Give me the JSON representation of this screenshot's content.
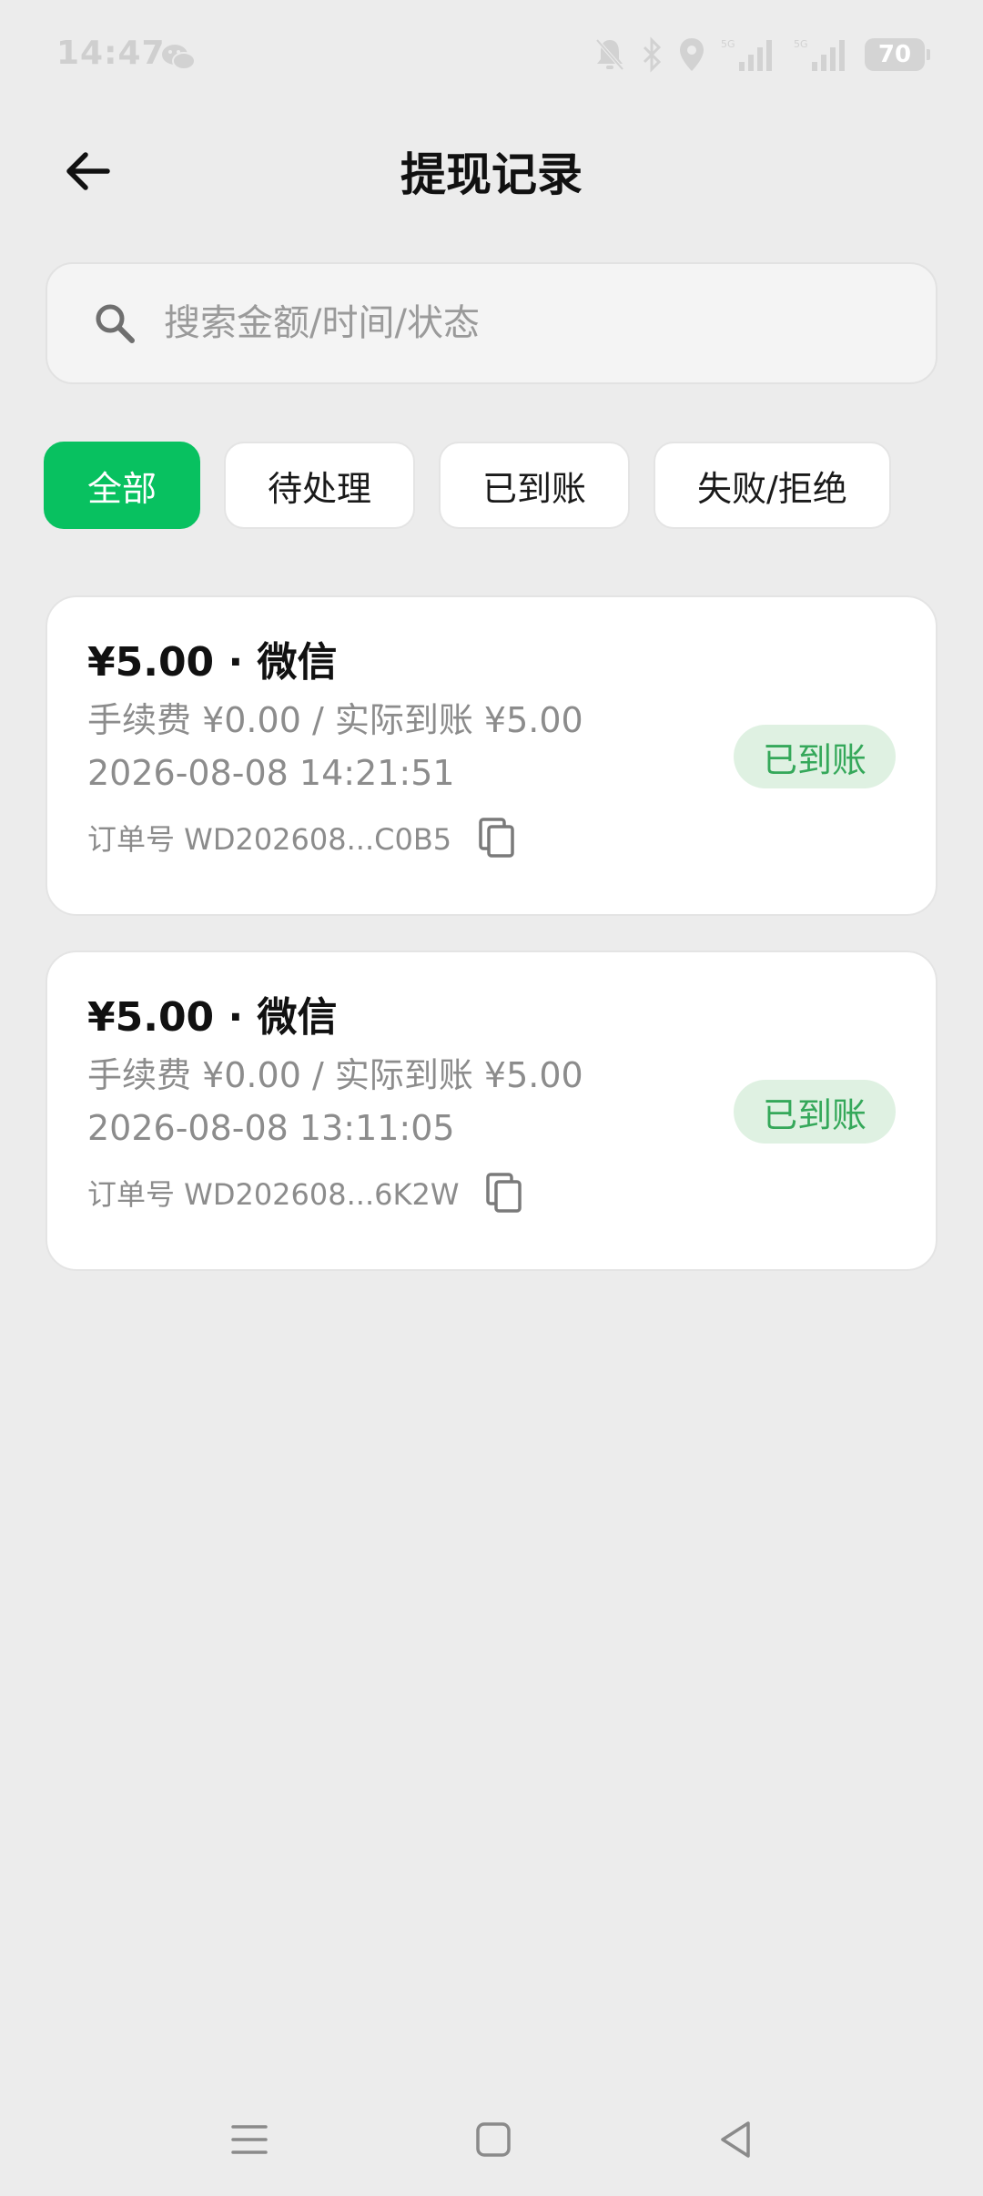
{
  "status_bar": {
    "time": "14:47",
    "battery": "70"
  },
  "header": {
    "title": "提现记录"
  },
  "search": {
    "placeholder": "搜索金额/时间/状态",
    "value": ""
  },
  "filters": [
    {
      "label": "全部",
      "active": true
    },
    {
      "label": "待处理",
      "active": false
    },
    {
      "label": "已到账",
      "active": false
    },
    {
      "label": "失败/拒绝",
      "active": false
    }
  ],
  "records": [
    {
      "title": "¥5.00 · 微信",
      "fee_line": "手续费 ¥0.00 / 实际到账 ¥5.00",
      "time": "2026-08-08 14:21:51",
      "order": "订单号 WD202608...C0B5",
      "status": "已到账"
    },
    {
      "title": "¥5.00 · 微信",
      "fee_line": "手续费 ¥0.00 / 实际到账 ¥5.00",
      "time": "2026-08-08 13:11:05",
      "order": "订单号 WD202608...6K2W",
      "status": "已到账"
    }
  ],
  "colors": {
    "accent": "#08c160",
    "background": "#ececec",
    "badge_bg": "#dff1e2",
    "badge_text": "#35a85a"
  },
  "icons": {
    "status_left": "wechat-icon",
    "status_right": [
      "mute-icon",
      "bluetooth-icon",
      "location-icon",
      "signal-5g-icon",
      "signal-5g-icon",
      "battery-icon"
    ],
    "back": "arrow-left-icon",
    "search": "search-icon",
    "copy": "copy-icon",
    "nav": [
      "menu-icon",
      "home-icon",
      "back-triangle-icon"
    ]
  }
}
